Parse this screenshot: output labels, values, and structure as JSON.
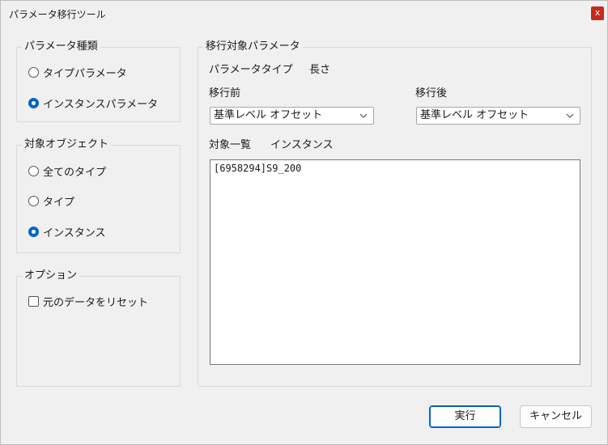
{
  "window": {
    "title": "パラメータ移行ツール",
    "close_glyph": "x"
  },
  "param_kind": {
    "legend": "パラメータ種類",
    "options": [
      {
        "label": "タイプパラメータ",
        "checked": false
      },
      {
        "label": "インスタンスパラメータ",
        "checked": true
      }
    ]
  },
  "target_object": {
    "legend": "対象オブジェクト",
    "options": [
      {
        "label": "全てのタイプ",
        "checked": false
      },
      {
        "label": "タイプ",
        "checked": false
      },
      {
        "label": "インスタンス",
        "checked": true
      }
    ]
  },
  "options_group": {
    "legend": "オプション",
    "reset_label": "元のデータをリセット",
    "reset_checked": false
  },
  "migration": {
    "legend": "移行対象パラメータ",
    "param_type_label": "パラメータタイプ",
    "param_type_value": "長さ",
    "before_label": "移行前",
    "before_value": "基準レベル オフセット",
    "after_label": "移行後",
    "after_value": "基準レベル オフセット",
    "list_label": "対象一覧",
    "list_kind": "インスタンス",
    "items": [
      "[6958294]S9_200"
    ]
  },
  "buttons": {
    "run": "実行",
    "cancel": "キャンセル"
  },
  "colors": {
    "accent": "#0067c0",
    "close": "#c42b1c"
  }
}
